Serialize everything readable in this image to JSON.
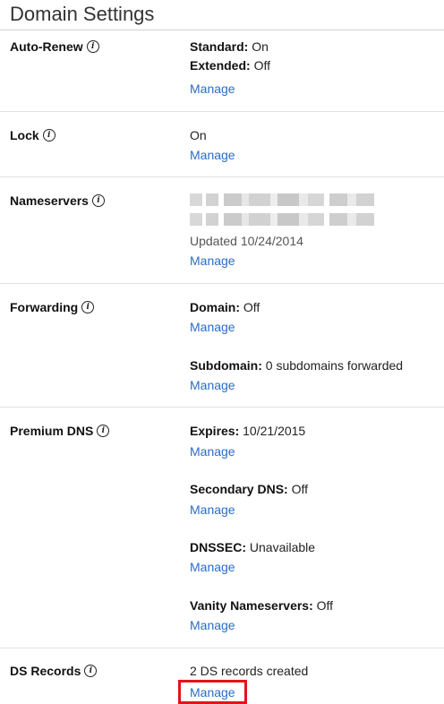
{
  "page": {
    "title": "Domain Settings"
  },
  "rows": {
    "auto_renew": {
      "label": "Auto-Renew",
      "standard_label": "Standard:",
      "standard_value": " On",
      "extended_label": "Extended:",
      "extended_value": " Off",
      "manage": "Manage"
    },
    "lock": {
      "label": "Lock",
      "value": "On",
      "manage": "Manage"
    },
    "nameservers": {
      "label": "Nameservers",
      "updated": "Updated 10/24/2014",
      "manage": "Manage"
    },
    "forwarding": {
      "label": "Forwarding",
      "domain_label": "Domain:",
      "domain_value": " Off",
      "manage_domain": "Manage",
      "subdomain_label": "Subdomain:",
      "subdomain_value": " 0 subdomains forwarded",
      "manage_subdomain": "Manage"
    },
    "premium_dns": {
      "label": "Premium DNS",
      "expires_label": "Expires:",
      "expires_value": " 10/21/2015",
      "manage_expires": "Manage",
      "secondary_label": "Secondary DNS:",
      "secondary_value": " Off",
      "manage_secondary": "Manage",
      "dnssec_label": "DNSSEC:",
      "dnssec_value": " Unavailable",
      "manage_dnssec": "Manage",
      "vanity_label": "Vanity Nameservers:",
      "vanity_value": " Off",
      "manage_vanity": "Manage"
    },
    "ds_records": {
      "label": "DS Records",
      "value": "2 DS records created",
      "manage": "Manage"
    }
  },
  "colors": {
    "link": "#2a6cc9",
    "highlight": "#e0151b"
  },
  "icons": {
    "info": "info-circle-icon"
  }
}
